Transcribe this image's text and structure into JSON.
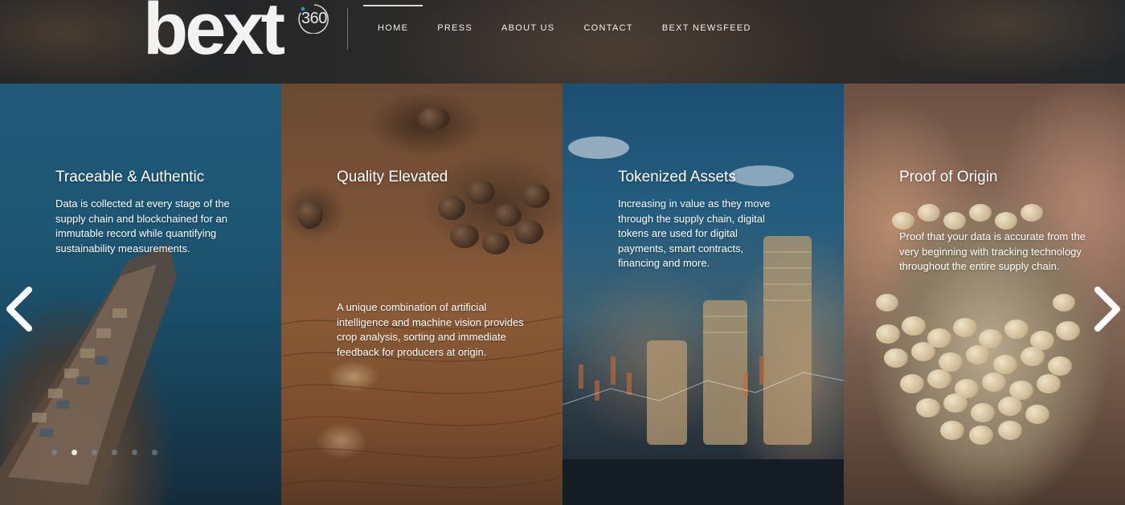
{
  "brand": {
    "logo_word": "bext",
    "logo_number": "360"
  },
  "nav": {
    "items": [
      {
        "label": "HOME",
        "active": true
      },
      {
        "label": "PRESS",
        "active": false
      },
      {
        "label": "ABOUT US",
        "active": false
      },
      {
        "label": "CONTACT",
        "active": false
      },
      {
        "label": "BEXT NEWSFEED",
        "active": false
      }
    ]
  },
  "panels": [
    {
      "title": "Traceable & Authentic",
      "text": "Data is collected at every stage of the supply chain and blockchained for an immutable record while quantifying sustainability measurements."
    },
    {
      "title": "Quality Elevated",
      "text": "A unique combination of artificial intelligence and machine vision provides crop analysis, sorting and immediate feedback for producers at origin."
    },
    {
      "title": "Tokenized Assets",
      "text": "Increasing in value as they move through the supply chain, digital tokens are used for digital payments, smart contracts, financing and more."
    },
    {
      "title": "Proof of Origin",
      "text": "Proof that your data is accurate from the very beginning with tracking technology throughout the entire supply chain."
    }
  ],
  "carousel": {
    "prev_icon": "chevron-left-icon",
    "next_icon": "chevron-right-icon",
    "dot_count": 6,
    "active_dot": 2
  },
  "colors": {
    "panel_blue": "#1d5673",
    "panel_orange": "#7a5236",
    "text": "#ffffff"
  }
}
